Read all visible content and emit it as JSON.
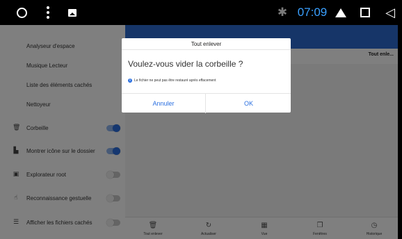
{
  "statusbar": {
    "time": "07:09",
    "time_color": "#3aa0ff",
    "icons": [
      "circle-icon",
      "menu-dots-icon",
      "image-icon",
      "bluetooth-icon",
      "eject-icon",
      "square-icon",
      "back-icon"
    ]
  },
  "drawer": {
    "items": [
      {
        "label": "Analyseur d'espace"
      },
      {
        "label": "Musique Lecteur"
      },
      {
        "label": "Liste des éléments cachés"
      },
      {
        "label": "Nettoyeur"
      },
      {
        "label": "Corbeille",
        "icon": "trash-icon",
        "toggle": true
      },
      {
        "label": "Montrer icône sur le dossier",
        "icon": "folder-icon",
        "toggle": true
      },
      {
        "label": "Explorateur root",
        "icon": "root-icon",
        "toggle": false
      },
      {
        "label": "Reconnaissance gestuelle",
        "icon": "gesture-icon",
        "toggle": false
      },
      {
        "label": "Afficher les fichiers cachés",
        "icon": "hidden-files-icon",
        "toggle": false
      }
    ]
  },
  "main": {
    "column_header": "Tout enle...",
    "bottom_bar": [
      {
        "label": "Tout enlever",
        "icon": "trash-icon"
      },
      {
        "label": "Actualiser",
        "icon": "refresh-icon"
      },
      {
        "label": "Vue",
        "icon": "grid-view-icon"
      },
      {
        "label": "Fenêtres",
        "icon": "windows-icon"
      },
      {
        "label": "Historique",
        "icon": "history-icon"
      }
    ]
  },
  "dialog": {
    "title": "Tout enlever",
    "question": "Voulez-vous vider la corbeille ?",
    "info": "Le fichier ne peut pas être restauré après effacement",
    "cancel_label": "Annuler",
    "ok_label": "OK",
    "accent": "#2a6fe0"
  }
}
